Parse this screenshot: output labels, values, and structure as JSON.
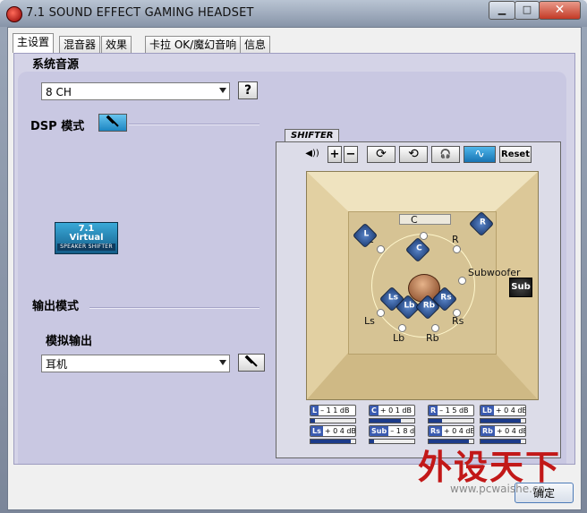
{
  "window": {
    "title": "7.1 SOUND EFFECT GAMING HEADSET"
  },
  "tabs": [
    "主设置",
    "混音器",
    "效果",
    "卡拉 OK/魔幻音响",
    "信息"
  ],
  "source": {
    "title": "系统音源",
    "selected": "8 CH",
    "help_label": "?"
  },
  "dsp": {
    "title": "DSP 模式",
    "badge": {
      "line1": "7.1",
      "line2": "Virtual",
      "line3": "SPEAKER SHIFTER"
    }
  },
  "output": {
    "title": "输出模式",
    "sub_title": "模拟输出",
    "selected": "耳机"
  },
  "shifter": {
    "tab_label": "SHIFTER",
    "reset_label": "Reset",
    "labels": {
      "L": "L",
      "C": "C",
      "R": "R",
      "Ls": "Ls",
      "Lb": "Lb",
      "Rb": "Rb",
      "Rs": "Rs",
      "Subwoofer": "Subwoofer"
    },
    "speakers": [
      "L",
      "C",
      "R",
      "Ls",
      "Lb",
      "Rb",
      "Rs",
      "Sub"
    ],
    "meters": [
      {
        "ch": "L",
        "value": "– 1 1 dB",
        "level": 0.1
      },
      {
        "ch": "C",
        "value": "+ 0 1 dB",
        "level": 0.7
      },
      {
        "ch": "R",
        "value": "– 1 5 dB",
        "level": 0.3
      },
      {
        "ch": "Lb",
        "value": "+ 0 4 dB",
        "level": 0.9
      },
      {
        "ch": "Ls",
        "value": "+ 0 4 dB",
        "level": 0.9
      },
      {
        "ch": "Sub",
        "value": "– 1 8 dB",
        "level": 0.1
      },
      {
        "ch": "Rs",
        "value": "+ 0 4 dB",
        "level": 0.9
      },
      {
        "ch": "Rb",
        "value": "+ 0 4 dB",
        "level": 0.9
      }
    ]
  },
  "footer": {
    "ok_label": "确定"
  },
  "watermark": {
    "text": "外设天下",
    "url": "www.pcwaishe.cn"
  }
}
